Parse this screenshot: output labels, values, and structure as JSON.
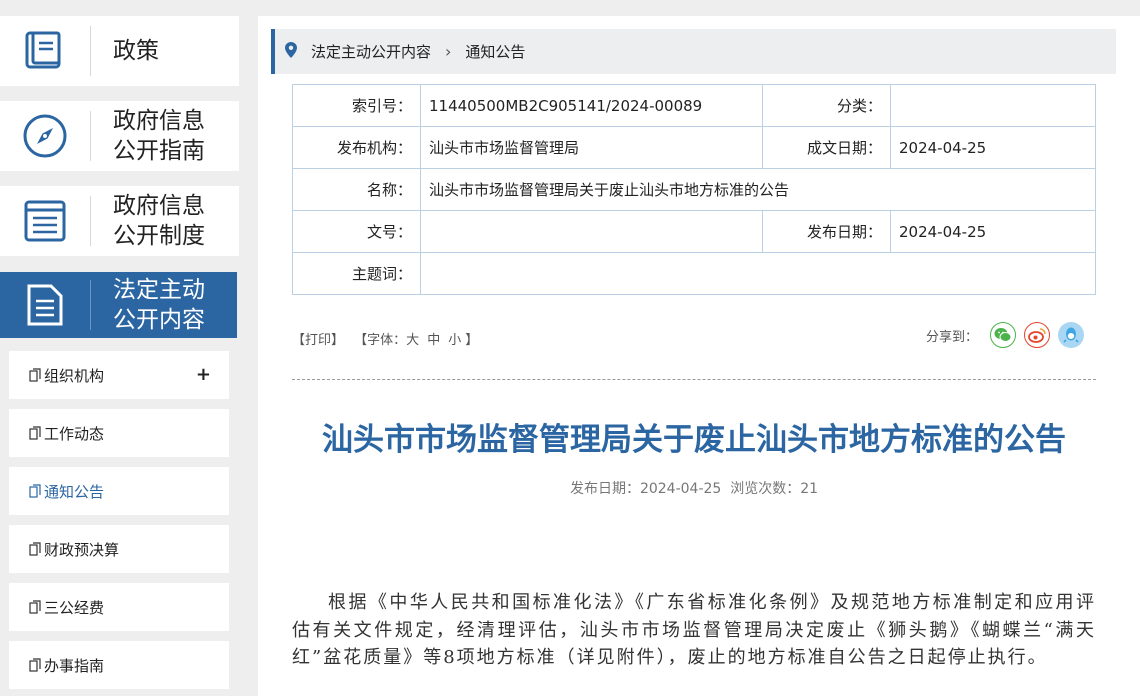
{
  "sidebar": {
    "big_items": [
      {
        "label": "政策",
        "icon": "book-icon"
      },
      {
        "label": "政府信息公开指南",
        "icon": "compass-icon"
      },
      {
        "label": "政府信息公开制度",
        "icon": "list-icon"
      },
      {
        "label": "法定主动公开内容",
        "icon": "document-icon",
        "active": true
      }
    ],
    "big_labels": [
      [
        "政策"
      ],
      [
        "政府信息",
        "公开指南"
      ],
      [
        "政府信息",
        "公开制度"
      ],
      [
        "法定主动",
        "公开内容"
      ]
    ],
    "sub_items": [
      {
        "label": "组织机构",
        "expand": "+"
      },
      {
        "label": "工作动态"
      },
      {
        "label": "通知公告",
        "current": true
      },
      {
        "label": "财政预决算"
      },
      {
        "label": "三公经费"
      },
      {
        "label": "办事指南"
      }
    ]
  },
  "breadcrumb": {
    "items": [
      "法定主动公开内容",
      "通知公告"
    ],
    "separator": "›"
  },
  "meta": {
    "index_label": "索引号：",
    "index_value": "11440500MB2C905141/2024-00089",
    "category_label": "分类：",
    "category_value": "",
    "publisher_label": "发布机构：",
    "publisher_value": "汕头市市场监督管理局",
    "created_label": "成文日期：",
    "created_value": "2024-04-25",
    "name_label": "名称：",
    "name_value": "汕头市市场监督管理局关于废止汕头市地方标准的公告",
    "docno_label": "文号：",
    "docno_value": "",
    "pubdate_label": "发布日期：",
    "pubdate_value": "2024-04-25",
    "subject_label": "主题词：",
    "subject_value": ""
  },
  "tools": {
    "print": "【打印】",
    "font_prefix": "【字体：",
    "font_large": "大",
    "font_medium": "中",
    "font_small": "小",
    "font_suffix": "】",
    "share_label": "分享到："
  },
  "share_icons": [
    "wechat-icon",
    "weibo-icon",
    "qq-icon"
  ],
  "colors": {
    "accent": "#2b66a3",
    "wechat": "#4cb34a",
    "weibo": "#e5462d",
    "qq": "#3ea6e2"
  },
  "article": {
    "title": "汕头市市场监督管理局关于废止汕头市地方标准的公告",
    "pub_info": "发布日期：2024-04-25  浏览次数：21",
    "paragraph": "根据《中华人民共和国标准化法》《广东省标准化条例》及规范地方标准制定和应用评估有关文件规定，经清理评估，汕头市市场监督管理局决定废止《狮头鹅》《蝴蝶兰“满天红”盆花质量》等8项地方标准（详见附件），废止的地方标准自公告之日起停止执行。"
  }
}
